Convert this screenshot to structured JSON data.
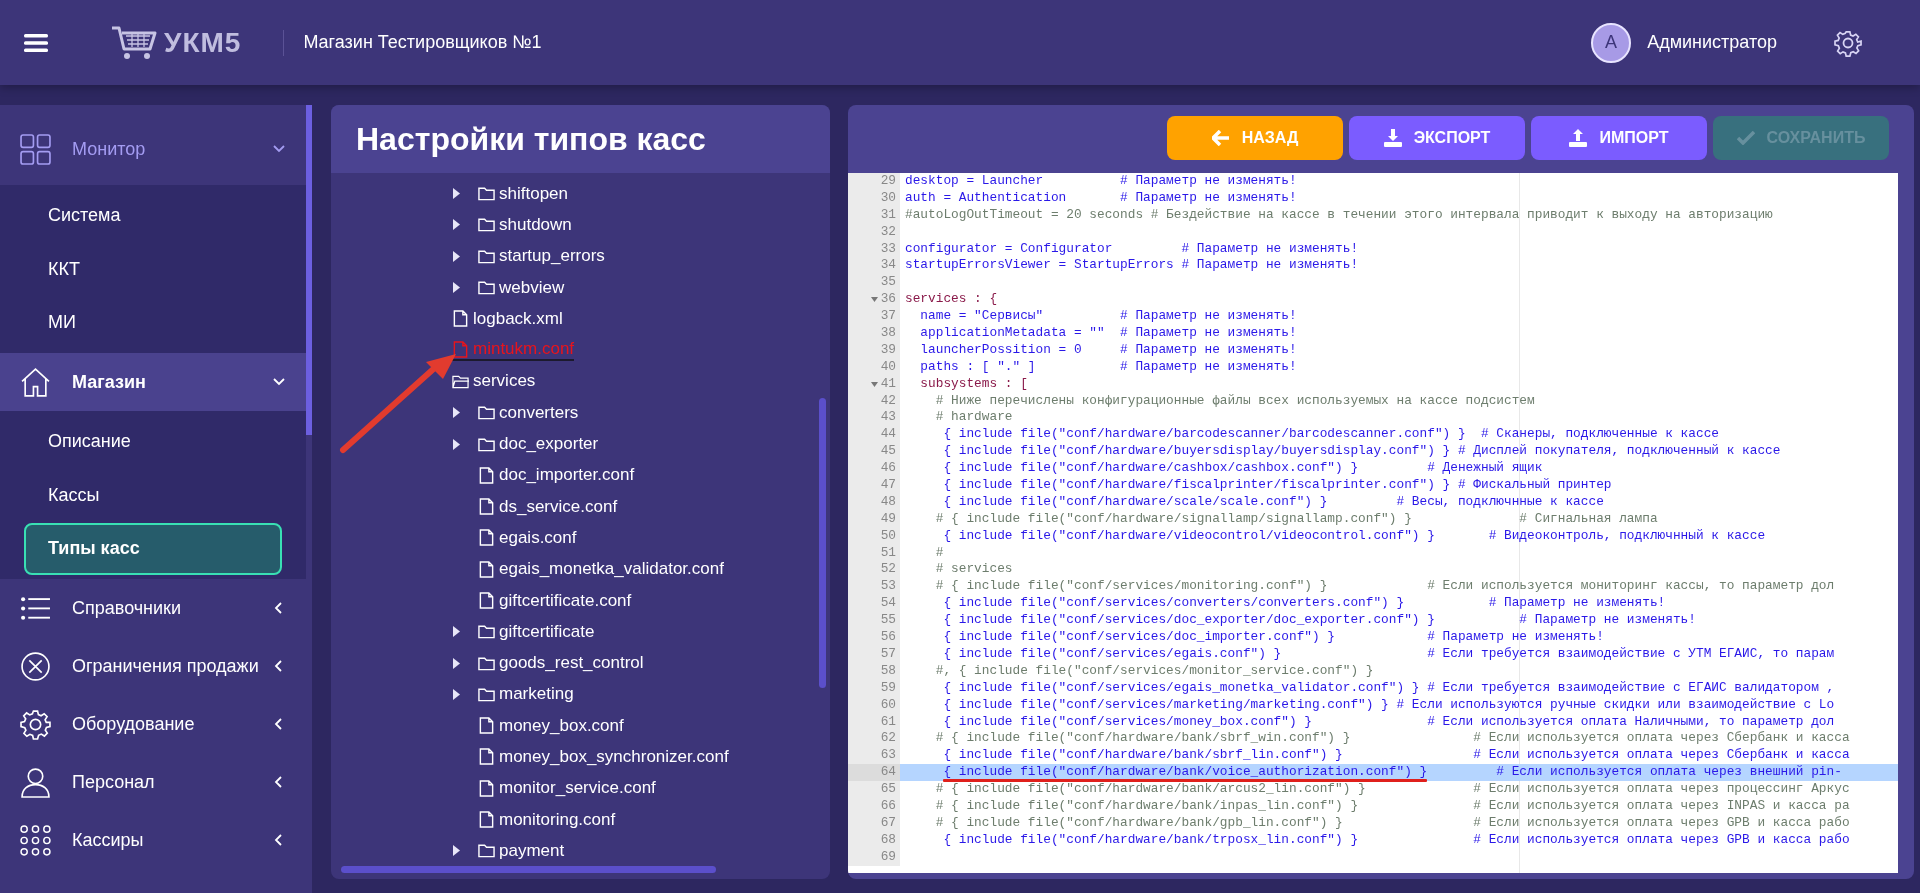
{
  "header": {
    "app_name": "УКМ5",
    "store": "Магазин Тестировщиков №1",
    "user_initial": "A",
    "user_name": "Администратор"
  },
  "sidebar": {
    "sections": [
      {
        "label": "Монитор",
        "expanded": true,
        "active": false,
        "hovered": true,
        "children": [
          {
            "label": "Система",
            "selected": false
          },
          {
            "label": "ККТ",
            "selected": false
          },
          {
            "label": "МИ",
            "selected": false
          }
        ]
      },
      {
        "label": "Магазин",
        "expanded": true,
        "active": true,
        "hovered": false,
        "children": [
          {
            "label": "Описание",
            "selected": false
          },
          {
            "label": "Кассы",
            "selected": false
          },
          {
            "label": "Типы касс",
            "selected": true
          }
        ]
      },
      {
        "label": "Справочники",
        "expanded": false,
        "active": false,
        "hovered": false
      },
      {
        "label": "Ограничения продажи",
        "expanded": false,
        "active": false,
        "hovered": false
      },
      {
        "label": "Оборудование",
        "expanded": false,
        "active": false,
        "hovered": false
      },
      {
        "label": "Персонал",
        "expanded": false,
        "active": false,
        "hovered": false
      },
      {
        "label": "Кассиры",
        "expanded": false,
        "active": false,
        "hovered": false
      }
    ]
  },
  "tree_panel": {
    "title": "Настройки типов касс",
    "items": [
      {
        "children": [
          {
            "kind": "folder",
            "label": "shiftopen",
            "expanded": false
          },
          {
            "kind": "folder",
            "label": "shutdown",
            "expanded": false
          },
          {
            "kind": "folder",
            "label": "startup_errors",
            "expanded": false
          },
          {
            "kind": "folder",
            "label": "webview",
            "expanded": false
          }
        ]
      },
      {
        "kind": "file",
        "label": "logback.xml",
        "marked": false
      },
      {
        "kind": "file",
        "label": "mintukm.conf",
        "marked": true
      },
      {
        "kind": "folder",
        "label": "services",
        "expanded": true,
        "children": [
          {
            "kind": "folder",
            "label": "converters",
            "expanded": false
          },
          {
            "kind": "folder",
            "label": "doc_exporter",
            "expanded": false
          },
          {
            "kind": "file",
            "label": "doc_importer.conf",
            "marked": false
          },
          {
            "kind": "file",
            "label": "ds_service.conf",
            "marked": false
          },
          {
            "kind": "file",
            "label": "egais.conf",
            "marked": false
          },
          {
            "kind": "file",
            "label": "egais_monetka_validator.conf",
            "marked": false
          },
          {
            "kind": "file",
            "label": "giftcertificate.conf",
            "marked": false
          },
          {
            "kind": "folder",
            "label": "giftcertificate",
            "expanded": false
          },
          {
            "kind": "folder",
            "label": "goods_rest_control",
            "expanded": false
          },
          {
            "kind": "folder",
            "label": "marketing",
            "expanded": false
          },
          {
            "kind": "file",
            "label": "money_box.conf",
            "marked": false
          },
          {
            "kind": "file",
            "label": "money_box_synchronizer.conf",
            "marked": false
          },
          {
            "kind": "file",
            "label": "monitor_service.conf",
            "marked": false
          },
          {
            "kind": "file",
            "label": "monitoring.conf",
            "marked": false
          },
          {
            "kind": "folder",
            "label": "payment",
            "expanded": false
          }
        ]
      }
    ]
  },
  "toolbar": [
    {
      "kind": "back",
      "label": "НАЗАД",
      "disabled": false
    },
    {
      "kind": "export",
      "label": "ЭКСПОРТ",
      "disabled": false
    },
    {
      "kind": "import",
      "label": "ИМПОРТ",
      "disabled": false
    },
    {
      "kind": "save",
      "label": "СОХРАНИТЬ",
      "disabled": true
    }
  ],
  "editor": {
    "lines": [
      {
        "number": "29",
        "kind": "code",
        "text": "desktop = Launcher          # Параметр не изменять!"
      },
      {
        "number": "30",
        "kind": "code",
        "text": "auth = Authentication       # Параметр не изменять!"
      },
      {
        "number": "31",
        "kind": "comment",
        "text": "#autoLogOutTimeout = 20 seconds # Бездействие на кассе в течении этого интервала приводит к выходу на авторизацию"
      },
      {
        "number": "32"
      },
      {
        "number": "33",
        "kind": "code",
        "text": "configurator = Configurator         # Параметр не изменять!"
      },
      {
        "number": "34",
        "kind": "code",
        "text": "startupErrorsViewer = StartupErrors # Параметр не изменять!"
      },
      {
        "number": "35"
      },
      {
        "number": "36",
        "kind": "block",
        "fold": true,
        "text": "services : {"
      },
      {
        "number": "37",
        "kind": "code",
        "text": "  name = \"Сервисы\"          # Параметр не изменять!"
      },
      {
        "number": "38",
        "kind": "code",
        "text": "  applicationMetadata = \"\"  # Параметр не изменять!"
      },
      {
        "number": "39",
        "kind": "code",
        "text": "  launcherPossition = 0     # Параметр не изменять!"
      },
      {
        "number": "40",
        "kind": "code",
        "text": "  paths : [ \".\" ]           # Параметр не изменять!"
      },
      {
        "number": "41",
        "kind": "block",
        "fold": true,
        "text": "  subsystems : ["
      },
      {
        "number": "42",
        "kind": "comment",
        "text": "    # Ниже перечислены конфигурационные файлы всех используемых на кассе подсистем"
      },
      {
        "number": "43",
        "kind": "comment",
        "text": "    # hardware"
      },
      {
        "number": "44",
        "kind": "code",
        "text": "     { include file(\"conf/hardware/barcodescanner/barcodescanner.conf\") }  # Сканеры, подключенные к кассе"
      },
      {
        "number": "45",
        "kind": "code",
        "text": "     { include file(\"conf/hardware/buyersdisplay/buyersdisplay.conf\") } # Дисплей покупателя, подключенный к кассе"
      },
      {
        "number": "46",
        "kind": "code",
        "text": "     { include file(\"conf/hardware/cashbox/cashbox.conf\") }         # Денежный ящик"
      },
      {
        "number": "47",
        "kind": "code",
        "text": "     { include file(\"conf/hardware/fiscalprinter/fiscalprinter.conf\") } # Фискальный принтер"
      },
      {
        "number": "48",
        "kind": "code",
        "text": "     { include file(\"conf/hardware/scale/scale.conf\") }         # Весы, подключнные к кассе"
      },
      {
        "number": "49",
        "kind": "comment",
        "text": "    # { include file(\"conf/hardware/signallamp/signallamp.conf\") }              # Сигнальная лампа"
      },
      {
        "number": "50",
        "kind": "code",
        "text": "     { include file(\"conf/hardware/videocontrol/videocontrol.conf\") }       # Видеоконтроль, подключнный к кассе"
      },
      {
        "number": "51",
        "kind": "comment",
        "text": "    #"
      },
      {
        "number": "52",
        "kind": "comment",
        "text": "    # services"
      },
      {
        "number": "53",
        "kind": "comment",
        "text": "    # { include file(\"conf/services/monitoring.conf\") }             # Если используется мониторинг кассы, то параметр дол"
      },
      {
        "number": "54",
        "kind": "code",
        "text": "     { include file(\"conf/services/converters/converters.conf\") }           # Параметр не изменять!"
      },
      {
        "number": "55",
        "kind": "code",
        "text": "     { include file(\"conf/services/doc_exporter/doc_exporter.conf\") }           # Параметр не изменять!"
      },
      {
        "number": "56",
        "kind": "code",
        "text": "     { include file(\"conf/services/doc_importer.conf\") }            # Параметр не изменять!"
      },
      {
        "number": "57",
        "kind": "code",
        "text": "     { include file(\"conf/services/egais.conf\") }                   # Если требуется взаимодействие с УТМ ЕГАИС, то парам"
      },
      {
        "number": "58",
        "kind": "comment",
        "text": "    #, { include file(\"conf/services/monitor_service.conf\") }"
      },
      {
        "number": "59",
        "kind": "code",
        "text": "     { include file(\"conf/services/egais_monetka_validator.conf\") } # Если требуется взаимодействие с ЕГАИС валидатором ,"
      },
      {
        "number": "60",
        "kind": "code",
        "text": "     { include file(\"conf/services/marketing/marketing.conf\") } # Если используются ручные скидки или взаимодействие с Lo"
      },
      {
        "number": "61",
        "kind": "code",
        "text": "     { include file(\"conf/services/money_box.conf\") }               # Если используется оплата Наличными, то параметр дол"
      },
      {
        "number": "62",
        "kind": "comment",
        "text": "    # { include file(\"conf/hardware/bank/sbrf_win.conf\") }                # Если используется оплата через Сбербанк и касса"
      },
      {
        "number": "63",
        "kind": "code",
        "text": "     { include file(\"conf/hardware/bank/sbrf_lin.conf\") }                 # Если используется оплата через Сбербанк и касса"
      },
      {
        "number": "64",
        "kind": "code",
        "selected": true,
        "underlined": true,
        "text": "     { include file(\"conf/hardware/bank/voice_authorization.conf\") }         # Если используется оплата через внешний pin-"
      },
      {
        "number": "65",
        "kind": "comment",
        "text": "    # { include file(\"conf/hardware/bank/arcus2_lin.conf\") }              # Если используется оплата через процессинг Аркус"
      },
      {
        "number": "66",
        "kind": "comment",
        "text": "    # { include file(\"conf/hardware/bank/inpas_lin.conf\") }               # Если используется оплата через INPAS и касса ра"
      },
      {
        "number": "67",
        "kind": "comment",
        "text": "    # { include file(\"conf/hardware/bank/gpb_lin.conf\") }                 # Если используется оплата через GPB и касса рабо"
      },
      {
        "number": "68",
        "kind": "code",
        "text": "     { include file(\"conf/hardware/bank/trposx_lin.conf\") }               # Если используется оплата через GPB и касса рабо"
      },
      {
        "number": "69"
      }
    ]
  }
}
